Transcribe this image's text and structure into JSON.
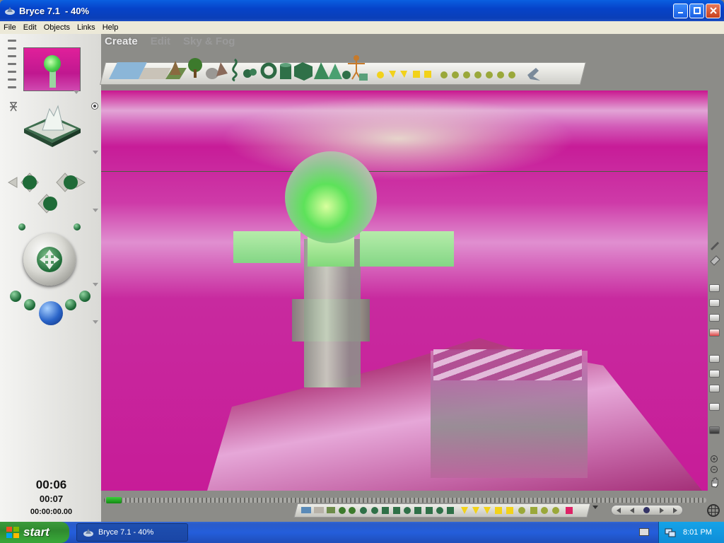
{
  "window": {
    "title": "Bryce 7.1  - 40%"
  },
  "menu": [
    "File",
    "Edit",
    "Objects",
    "Links",
    "Help"
  ],
  "palette": {
    "tabs": [
      {
        "label": "Create",
        "active": true
      },
      {
        "label": "Edit",
        "active": false
      },
      {
        "label": "Sky & Fog",
        "active": false
      }
    ]
  },
  "time": {
    "current": "00:06",
    "frame": "00:07",
    "timecode": "00:00:00.00"
  },
  "taskbar": {
    "start_label": "start",
    "task_label": "Bryce 7.1 - 40%",
    "clock": "8:01 PM"
  },
  "colors": {
    "accent": "#0a5fe0",
    "scene_pink": "#c71c98",
    "object_green": "#7fdc82",
    "start_green": "#3c9b3c"
  }
}
